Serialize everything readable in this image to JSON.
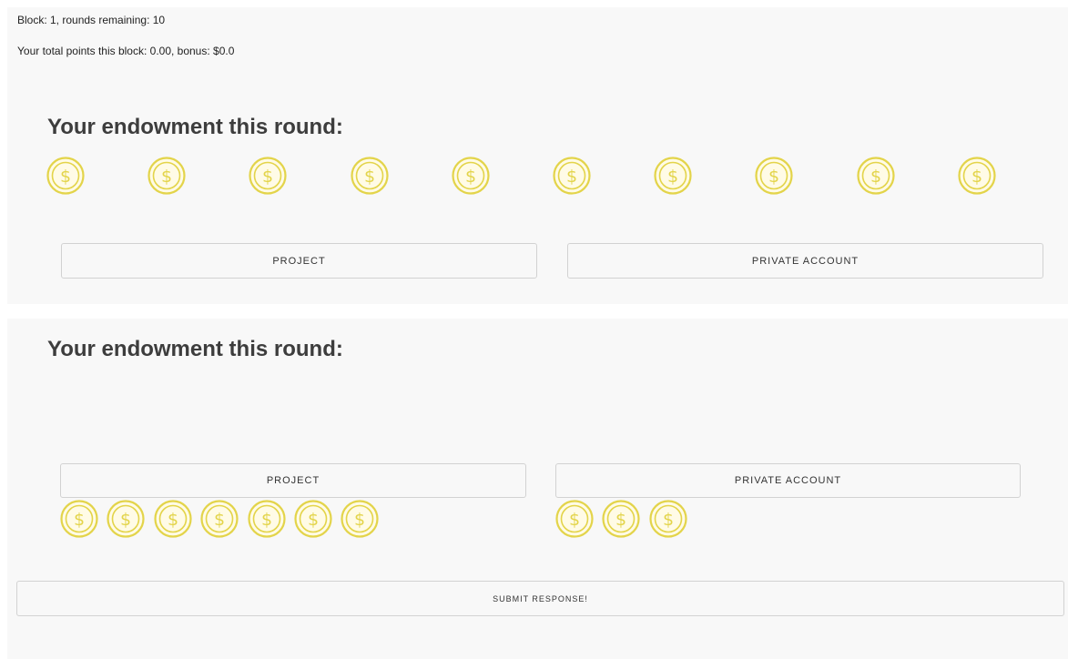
{
  "status": {
    "block_line": "Block: 1, rounds remaining: 10",
    "points_line": "Your total points this block: 0.00, bonus: $0.0"
  },
  "endowment_panel": {
    "heading": "Your endowment this round:",
    "coin_count": 10,
    "coin_icon": "dollar-coin-icon",
    "project_label": "PROJECT",
    "private_label": "PRIVATE ACCOUNT"
  },
  "allocation_panel": {
    "heading": "Your endowment this round:",
    "project_label": "PROJECT",
    "private_label": "PRIVATE ACCOUNT",
    "project_coins": 7,
    "private_coins": 3,
    "submit_label": "SUBMIT RESPONSE!"
  },
  "colors": {
    "coin_gold": "#e3d44a",
    "coin_fill": "#fffbe6",
    "panel_bg": "#f8f8f8",
    "heading_text": "#3d3d3d"
  }
}
